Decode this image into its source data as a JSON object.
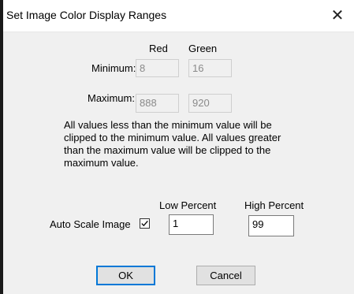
{
  "window": {
    "title": "Set Image Color Display Ranges",
    "close_glyph": "✕"
  },
  "ranges": {
    "col_red": "Red",
    "col_green": "Green",
    "minimum_label": "Minimum:",
    "maximum_label": "Maximum:",
    "min_red": "8",
    "min_green": "16",
    "max_red": "888",
    "max_green": "920"
  },
  "info_text": "All values less than the minimum value will be clipped to the minimum value.  All values greater than the maximum value will be clipped to the maximum value.",
  "autoscale": {
    "label": "Auto Scale Image",
    "checked": true,
    "low_label": "Low Percent",
    "high_label": "High Percent",
    "low_value": "1",
    "high_value": "99"
  },
  "buttons": {
    "ok": "OK",
    "cancel": "Cancel"
  },
  "colors": {
    "dialog_bg": "#f0f0f0",
    "default_button_border": "#0078d7"
  }
}
